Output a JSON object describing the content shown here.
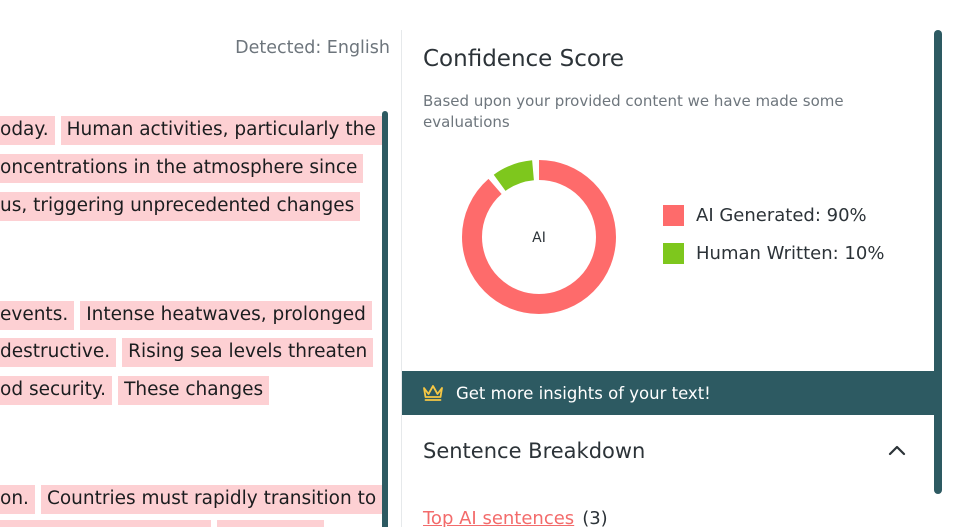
{
  "left": {
    "detected_label": "Detected: English",
    "lines": [
      [
        "oday.",
        "Human activities, particularly the"
      ],
      [
        "oncentrations in the atmosphere since"
      ],
      [
        "us, triggering unprecedented changes"
      ],
      [
        "events.",
        "Intense heatwaves, prolonged"
      ],
      [
        "destructive.",
        "Rising sea levels threaten"
      ],
      [
        "od security.",
        "These changes"
      ],
      [
        "on.",
        "Countries must rapidly transition to"
      ]
    ]
  },
  "confidence": {
    "title": "Confidence Score",
    "description": "Based upon your provided content we have made some evaluations",
    "donut_center_label": "AI",
    "ai_label": "AI Generated: 90%",
    "human_label": "Human Written: 10%",
    "ai_percent": 90,
    "human_percent": 10,
    "ai_color": "#fe6b6b",
    "human_color": "#7ec71d"
  },
  "banner": {
    "text": "Get more insights of your text!",
    "icon": "crown-icon"
  },
  "breakdown": {
    "title": "Sentence Breakdown",
    "top_ai_label": "Top AI sentences",
    "top_ai_count": "(3)"
  }
}
